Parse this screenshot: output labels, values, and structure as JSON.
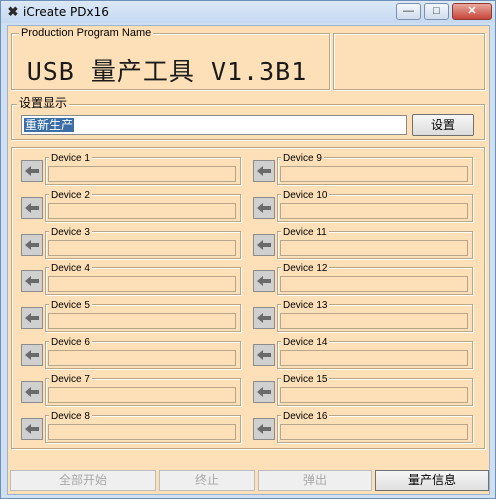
{
  "window": {
    "title": "iCreate PDx16",
    "minimize_glyph": "—",
    "restore_glyph": "□",
    "close_glyph": "✕"
  },
  "production": {
    "group_label": "Production Program Name",
    "program_name": "USB 量产工具 V1.3B1"
  },
  "settings": {
    "group_label": "设置显示",
    "value": "重新生产",
    "button_label": "设置"
  },
  "devices": [
    {
      "label": "Device 1"
    },
    {
      "label": "Device 2"
    },
    {
      "label": "Device 3"
    },
    {
      "label": "Device 4"
    },
    {
      "label": "Device 5"
    },
    {
      "label": "Device 6"
    },
    {
      "label": "Device 7"
    },
    {
      "label": "Device 8"
    },
    {
      "label": "Device 9"
    },
    {
      "label": "Device 10"
    },
    {
      "label": "Device 11"
    },
    {
      "label": "Device 12"
    },
    {
      "label": "Device 13"
    },
    {
      "label": "Device 14"
    },
    {
      "label": "Device 15"
    },
    {
      "label": "Device 16"
    }
  ],
  "bottom": {
    "start_all": "全部开始",
    "stop": "终止",
    "eject": "弹出",
    "info": "量产信息"
  },
  "colors": {
    "client_bg": "#fde0b8",
    "selection": "#3a6ea5"
  }
}
